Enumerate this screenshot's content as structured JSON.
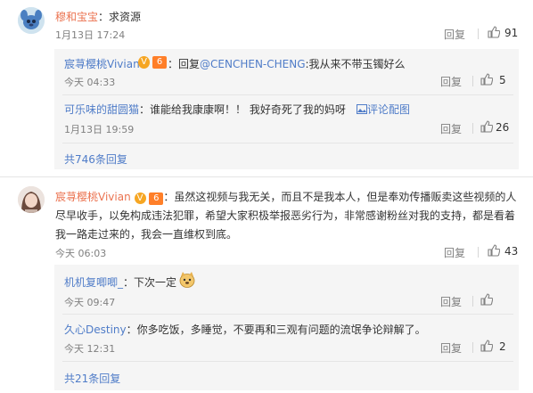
{
  "comments": [
    {
      "user": "穆和宝宝",
      "text": "：求资源",
      "time": "1月13日 17:24",
      "reply_label": "回复",
      "likes": "91",
      "subs": [
        {
          "user": "宸荨樱桃Vivian",
          "text_prefix": "：回复",
          "mention": "@CENCHEN-CHENG",
          "text": ":我从来不带玉镯好么",
          "time": "今天 04:33",
          "reply_label": "回复",
          "likes": "5"
        },
        {
          "user": "可乐味的甜圆猫",
          "text": "：谁能给我康康啊！！ 我好奇死了我的妈呀",
          "link": "评论配图",
          "time": "1月13日 19:59",
          "reply_label": "回复",
          "likes": "26"
        }
      ],
      "more": "共746条回复"
    },
    {
      "user": "宸荨樱桃Vivian",
      "text_lines": [
        "：虽然这视频与我无关，而且不是我本人，但是奉劝传播贩卖这些视频的人",
        "尽早收手，以免构成违法犯罪，希望大家积极举报恶劣行为，非常感谢粉丝对我的支持，都是看着",
        "我一路走过来的，我会一直维权到底。"
      ],
      "time": "今天 06:03",
      "reply_label": "回复",
      "likes": "43",
      "subs": [
        {
          "user": "机机复唧唧_",
          "text": "：下次一定",
          "time": "今天 09:47",
          "reply_label": "回复",
          "likes": ""
        },
        {
          "user": "久心Destiny",
          "text": "：你多吃饭，多睡觉，不要再和三观有问题的流氓争论辩解了。",
          "time": "今天 12:31",
          "reply_label": "回复",
          "likes": "2"
        }
      ],
      "more": "共21条回复"
    }
  ],
  "badges": {
    "vip": "V",
    "level": "6"
  },
  "colors": {
    "name": "#eb7350",
    "link": "#4f7cc8",
    "muted": "#808080",
    "panel": "#f5f5f5"
  }
}
